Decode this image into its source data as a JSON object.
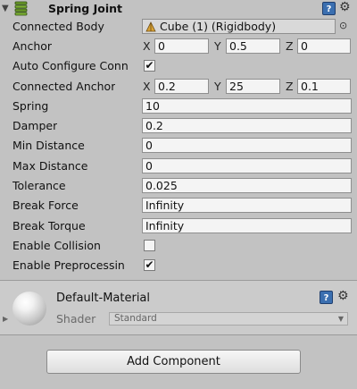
{
  "component": {
    "title": "Spring Joint",
    "icons": {
      "fold": "triangle-down-icon",
      "component": "spring-icon",
      "help": "help-book-icon",
      "settings": "gear-icon"
    }
  },
  "fields": {
    "connected_body": {
      "label": "Connected Body",
      "value": "Cube (1) (Rigidbody)",
      "icon": "rigidbody-icon",
      "picker_icon": "object-picker-icon"
    },
    "anchor": {
      "label": "Anchor",
      "x_label": "X",
      "x": "0",
      "y_label": "Y",
      "y": "0.5",
      "z_label": "Z",
      "z": "0"
    },
    "auto_configure": {
      "label": "Auto Configure Conn",
      "checked": true
    },
    "connected_anchor": {
      "label": "Connected Anchor",
      "x_label": "X",
      "x": "0.2",
      "y_label": "Y",
      "y": "25",
      "z_label": "Z",
      "z": "0.1"
    },
    "spring": {
      "label": "Spring",
      "value": "10"
    },
    "damper": {
      "label": "Damper",
      "value": "0.2"
    },
    "min_distance": {
      "label": "Min Distance",
      "value": "0"
    },
    "max_distance": {
      "label": "Max Distance",
      "value": "0"
    },
    "tolerance": {
      "label": "Tolerance",
      "value": "0.025"
    },
    "break_force": {
      "label": "Break Force",
      "value": "Infinity"
    },
    "break_torque": {
      "label": "Break Torque",
      "value": "Infinity"
    },
    "enable_collision": {
      "label": "Enable Collision",
      "checked": false
    },
    "enable_preprocessing": {
      "label": "Enable Preprocessin",
      "checked": true
    }
  },
  "material": {
    "name": "Default-Material",
    "shader_label": "Shader",
    "shader_value": "Standard"
  },
  "add_component_label": "Add Component",
  "check_glyph": "✔",
  "colors": {
    "background": "#c2c2c2",
    "field": "#f4f4f4",
    "help": "#3b6fb0"
  }
}
